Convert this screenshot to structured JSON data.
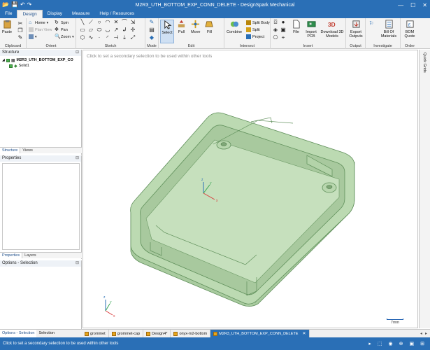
{
  "app": {
    "title": "M2R3_UTH_BOTTOM_EXP_CONN_DELETE - DesignSpark Mechanical",
    "quick_access": [
      "open-icon",
      "save-icon",
      "undo-icon",
      "redo-icon"
    ],
    "window_controls": [
      "minimize",
      "maximize",
      "close"
    ]
  },
  "ribbon_tabs": [
    {
      "label": "File",
      "active": false
    },
    {
      "label": "Design",
      "active": true
    },
    {
      "label": "Display",
      "active": false
    },
    {
      "label": "Measure",
      "active": false
    },
    {
      "label": "Help / Resources",
      "active": false
    }
  ],
  "ribbon": {
    "clipboard": {
      "label": "Clipboard",
      "paste": "Paste"
    },
    "orient": {
      "label": "Orient",
      "home": "Home",
      "spin": "Spin",
      "plan_view": "Plan View",
      "pan": "Pan",
      "zoom": "Zoom"
    },
    "sketch": {
      "label": "Sketch"
    },
    "mode": {
      "label": "Mode"
    },
    "edit": {
      "label": "Edit",
      "select": "Select",
      "pull": "Pull",
      "move": "Move",
      "fill": "Fill"
    },
    "intersect": {
      "label": "Intersect",
      "combine": "Combine",
      "split_body": "Split Body",
      "split": "Split",
      "project": "Project"
    },
    "insert": {
      "label": "Insert",
      "file": "File",
      "import_pcb": "Import PCB",
      "download_3d": "Download 3D Models"
    },
    "output": {
      "label": "Output",
      "export_outputs": "Export Outputs"
    },
    "investigate": {
      "label": "Investigate",
      "bill_of_materials": "Bill Of Materials"
    },
    "order": {
      "label": "Order",
      "bom_quote": "BOM Quote"
    }
  },
  "structure_panel": {
    "title": "Structure",
    "root": "M2R3_UTH_BOTTOM_EXP_CO",
    "children": [
      "Solid1"
    ],
    "tabs": [
      {
        "label": "Structure",
        "active": true
      },
      {
        "label": "Views",
        "active": false
      }
    ]
  },
  "properties_panel": {
    "title": "Properties",
    "tabs": [
      {
        "label": "Properties",
        "active": true
      },
      {
        "label": "Layers",
        "active": false
      }
    ]
  },
  "options_panel": {
    "title": "Options - Selection",
    "tabs": [
      {
        "label": "Options - Selection",
        "active": true
      },
      {
        "label": "Selection",
        "active": false
      }
    ]
  },
  "viewport": {
    "hint": "Click to set a secondary selection to be used within other tools",
    "scale_label": "7mm",
    "model_color": "#b9d8b0"
  },
  "quick_grids": {
    "label": "Quick Grids"
  },
  "document_tabs": [
    {
      "label": "grommet",
      "active": false
    },
    {
      "label": "grommet-cap",
      "active": false
    },
    {
      "label": "Design4*",
      "active": false
    },
    {
      "label": "onyx-m2-bottom",
      "active": false
    },
    {
      "label": "M2R3_UTH_BOTTOM_EXP_CONN_DELETE",
      "active": true
    }
  ],
  "status": {
    "message": "Click to set a secondary selection to be used within other tools"
  },
  "colors": {
    "accent": "#2a6fb6",
    "model": "#b9d8b0",
    "model_edge": "#5f8f5a"
  }
}
